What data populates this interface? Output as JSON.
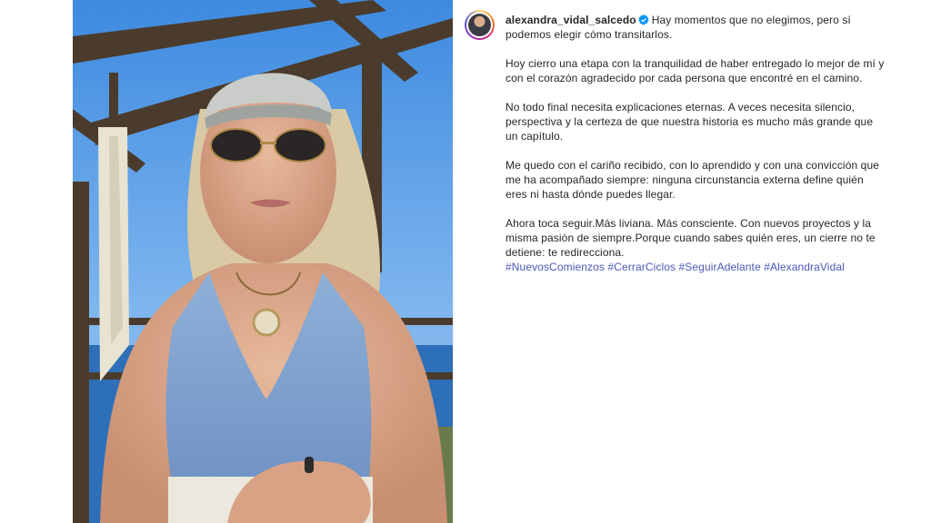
{
  "post": {
    "username": "alexandra_vidal_salcedo",
    "verified": true,
    "caption_first_line": "Hay momentos que no elegimos, pero sí podemos elegir cómo transitarlos.",
    "paragraphs": [
      "Hoy cierro una etapa con la tranquilidad de haber entregado lo mejor de mí y con el corazón agradecido por cada persona que encontré en el camino.",
      "No todo final necesita explicaciones eternas. A veces necesita silencio, perspectiva y la certeza de que nuestra historia es mucho más grande que un capítulo.",
      "Me quedo con el cariño recibido, con lo aprendido y con una convicción que me ha acompañado siempre: ninguna circunstancia externa define quién eres ni hasta dónde puedes llegar.",
      "Ahora toca seguir.Más liviana. Más consciente. Con nuevos proyectos y la misma pasión de siempre.Porque cuando sabes quién eres, un cierre no te detiene: te redirecciona."
    ],
    "hashtags": [
      "#NuevosComienzos",
      "#CerrarCiclos",
      "#SeguirAdelante",
      "#AlexandraVidal"
    ]
  },
  "colors": {
    "hashtag": "#4a58b8",
    "verified_badge": "#0095f6",
    "text": "#262626"
  }
}
